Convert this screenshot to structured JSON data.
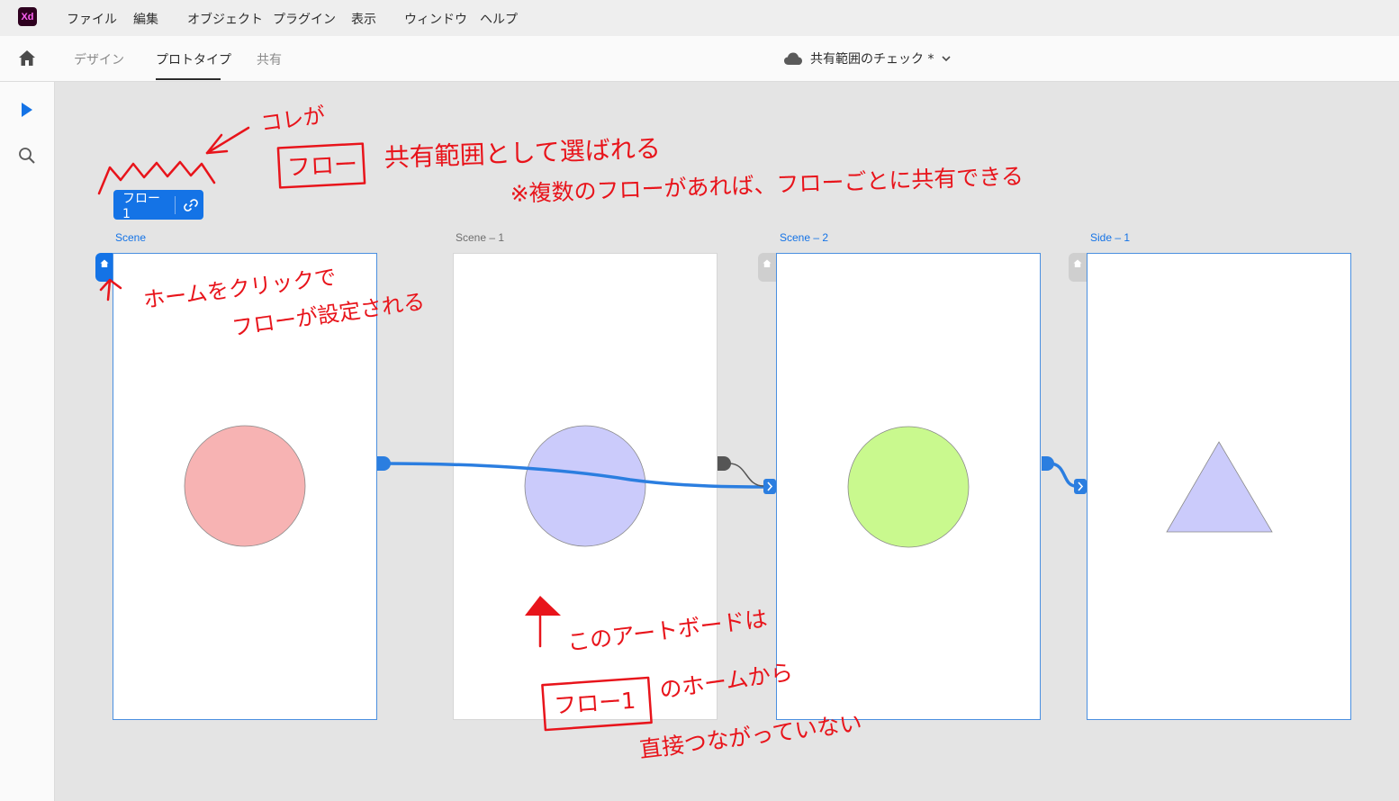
{
  "app": {
    "logo": "Xd",
    "menu": [
      "ファイル",
      "編集",
      "オブジェクト",
      "プラグイン",
      "表示",
      "ウィンドウ",
      "ヘルプ"
    ]
  },
  "tabs": {
    "items": [
      "デザイン",
      "プロトタイプ",
      "共有"
    ],
    "active": "プロトタイプ"
  },
  "document": {
    "title": "共有範囲のチェック *",
    "cloud_icon": "cloud-icon",
    "dropdown_icon": "chevron-down-icon"
  },
  "tools": [
    "select-arrow-icon",
    "zoom-search-icon"
  ],
  "flow": {
    "label": "フロー 1",
    "link_icon": "link-icon"
  },
  "artboards": [
    {
      "label": "Scene",
      "shape": "circle",
      "fill": "#f7b3b3",
      "is_flow_home": true,
      "selected": true
    },
    {
      "label": "Scene – 1",
      "shape": "circle",
      "fill": "#cbcbfb",
      "is_flow_home": false,
      "selected": false
    },
    {
      "label": "Scene – 2",
      "shape": "circle",
      "fill": "#c9f98e",
      "is_flow_home": false,
      "selected": true
    },
    {
      "label": "Side – 1",
      "shape": "triangle",
      "fill": "#cbcbfb",
      "is_flow_home": false,
      "selected": true
    }
  ],
  "annotations": {
    "flow_title_1": "コレが",
    "flow_title_2": "フロー",
    "flow_title_3": "共有範囲として選ばれる",
    "flow_note": "※複数のフローがあれば、フローごとに共有できる",
    "home_note_1": "ホームをクリックで",
    "home_note_2": "フローが設定される",
    "board_note_1": "このアートボードは",
    "board_note_2a": "フロー1",
    "board_note_2b": "のホームから",
    "board_note_3": "直接つながっていない"
  },
  "colors": {
    "accent": "#1473e6",
    "wire": "#2b7ee0",
    "annotation": "#e8141b"
  }
}
